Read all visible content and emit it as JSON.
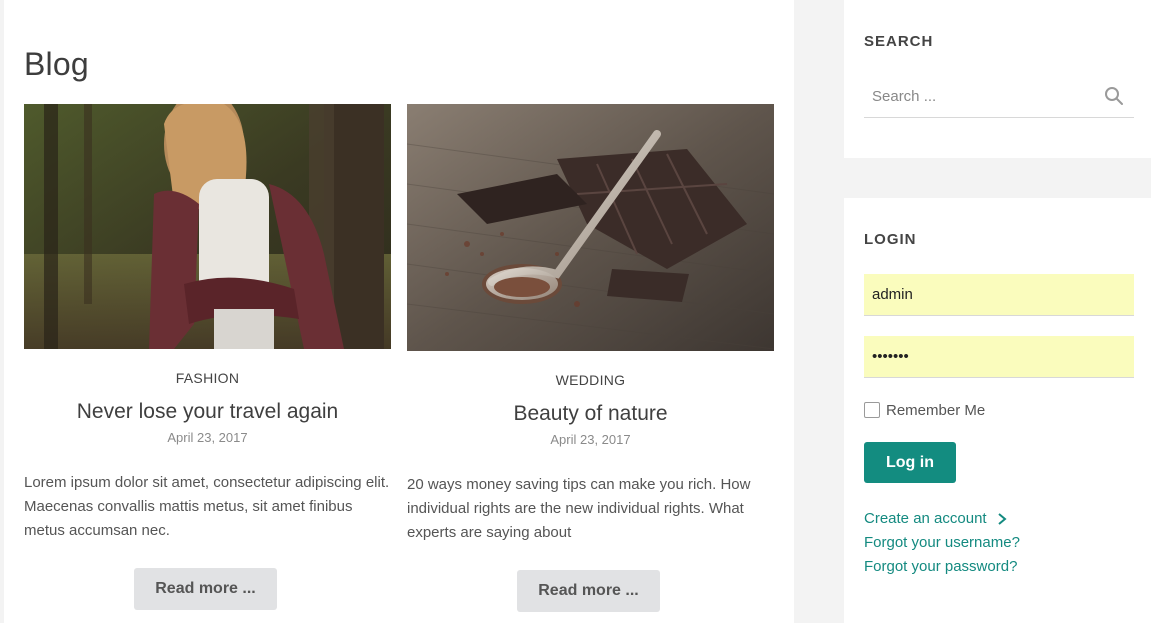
{
  "blog": {
    "title": "Blog",
    "posts": [
      {
        "category": "FASHION",
        "title": "Never lose your travel again",
        "date": "April 23, 2017",
        "excerpt": "Lorem ipsum dolor sit amet, consectetur adipiscing elit. Maecenas convallis mattis metus, sit amet finibus metus accumsan nec.",
        "read_more": "Read more ..."
      },
      {
        "category": "WEDDING",
        "title": "Beauty of nature",
        "date": "April 23, 2017",
        "excerpt": "20 ways money saving tips can make you rich. How individual rights are the new individual rights. What experts are saying about",
        "read_more": "Read more ..."
      }
    ]
  },
  "search": {
    "title": "SEARCH",
    "placeholder": "Search ...",
    "icon": "search-icon"
  },
  "login": {
    "title": "LOGIN",
    "username": "admin",
    "password": "•••••••",
    "remember_label": "Remember Me",
    "remember_checked": false,
    "submit_label": "Log in",
    "links": {
      "create_account": "Create an account",
      "forgot_username": "Forgot your username?",
      "forgot_password": "Forgot your password?"
    }
  },
  "colors": {
    "accent": "#138c80",
    "link": "#148a80",
    "autofill": "#fafcbd",
    "read_more_bg": "#e1e2e4"
  }
}
